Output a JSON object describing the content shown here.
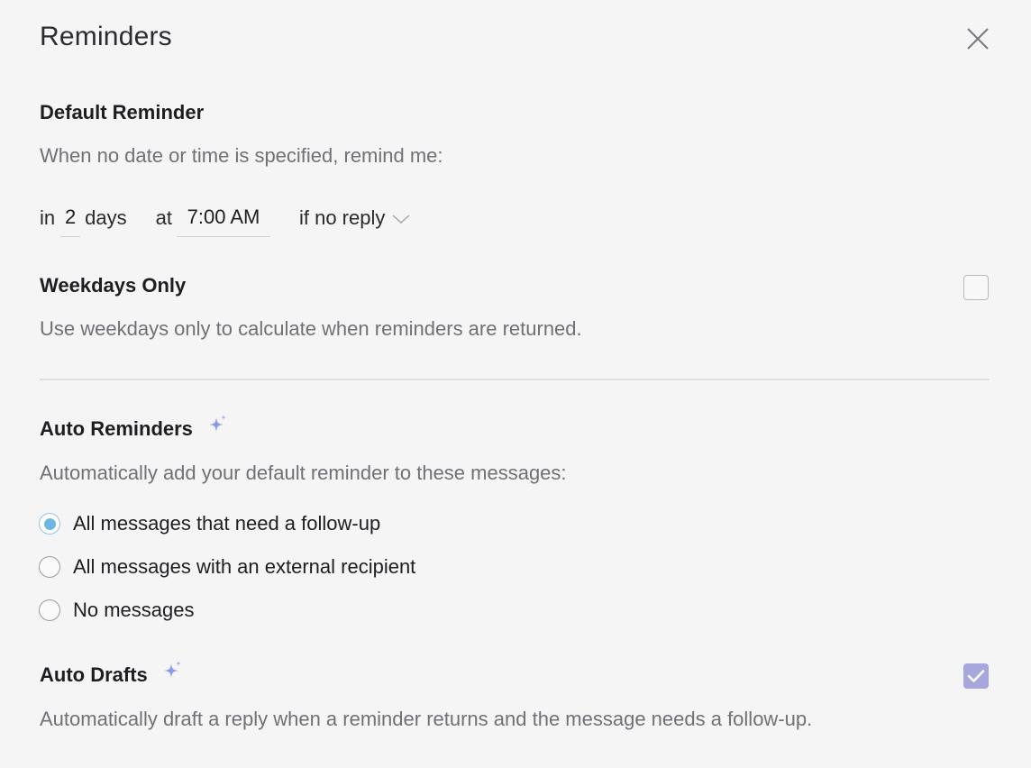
{
  "header": {
    "title": "Reminders",
    "close_icon": "close-icon"
  },
  "default_reminder": {
    "title": "Default Reminder",
    "description": "When no date or time is specified, remind me:",
    "in_label": "in",
    "days_value": "2",
    "days_label": "days",
    "at_label": "at",
    "time_value": "7:00 AM",
    "condition_selected": "if no reply"
  },
  "weekdays_only": {
    "title": "Weekdays Only",
    "description": "Use weekdays only to calculate when reminders are returned.",
    "checked": false
  },
  "auto_reminders": {
    "title": "Auto Reminders",
    "icon": "sparkle-icon",
    "description": "Automatically add your default reminder to these messages:",
    "options": [
      {
        "label": "All messages that need a follow-up",
        "selected": true
      },
      {
        "label": "All messages with an external recipient",
        "selected": false
      },
      {
        "label": "No messages",
        "selected": false
      }
    ]
  },
  "auto_drafts": {
    "title": "Auto Drafts",
    "icon": "sparkle-icon",
    "description": "Automatically draft a reply when a reminder returns and the message needs a follow-up.",
    "checked": true
  },
  "colors": {
    "background": "#f5f5f6",
    "accent_radio": "#6db6e4",
    "accent_checkbox": "#a7a6dd",
    "sparkle": "#8a9ae6"
  }
}
